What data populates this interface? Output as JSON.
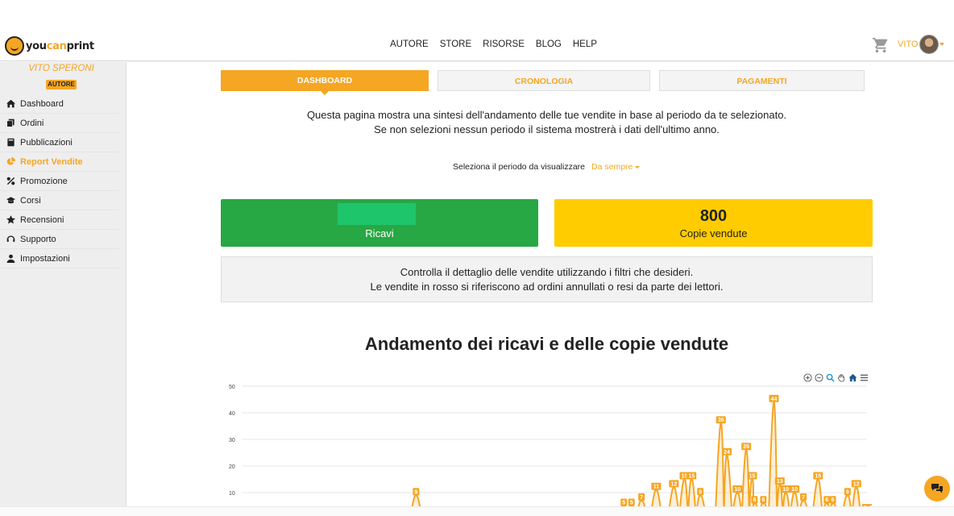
{
  "header": {
    "logo": {
      "you": "you",
      "can": "can",
      "print": "print"
    },
    "nav": [
      "AUTORE",
      "STORE",
      "RISORSE",
      "BLOG",
      "HELP"
    ],
    "user_name": "VITO",
    "accent": "#f5a623"
  },
  "sidebar": {
    "user": "VITO SPERONI",
    "role_badge": "AUTORE",
    "items": [
      {
        "label": "Dashboard",
        "icon": "home-icon"
      },
      {
        "label": "Ordini",
        "icon": "copy-icon"
      },
      {
        "label": "Pubblicazioni",
        "icon": "book-icon"
      },
      {
        "label": "Report Vendite",
        "icon": "pie-chart-icon",
        "active": true
      },
      {
        "label": "Promozione",
        "icon": "percent-icon"
      },
      {
        "label": "Corsi",
        "icon": "graduation-cap-icon"
      },
      {
        "label": "Recensioni",
        "icon": "star-icon"
      },
      {
        "label": "Supporto",
        "icon": "headset-icon"
      },
      {
        "label": "Impostazioni",
        "icon": "user-icon"
      }
    ]
  },
  "tabs": {
    "dashboard": "DASHBOARD",
    "cronologia": "CRONOLOGIA",
    "pagamenti": "PAGAMENTI"
  },
  "intro": {
    "line1": "Questa pagina mostra una sintesi dell'andamento delle tue vendite in base al periodo da te selezionato.",
    "line2": "Se non selezioni nessun periodo il sistema mostrerà i dati dell'ultimo anno."
  },
  "period": {
    "label": "Seleziona il periodo da visualizzare",
    "value": "Da sempre"
  },
  "stats": {
    "revenue_label": "Ricavi",
    "copies_value": "800",
    "copies_label": "Copie vendute",
    "colors": {
      "revenue": "#28a745",
      "copies": "#ffcc00"
    }
  },
  "info": {
    "line1": "Controlla il dettaglio delle vendite utilizzando i filtri che desideri.",
    "line2": "Le vendite in rosso si riferiscono ad ordini annullati o resi da parte dei lettori."
  },
  "chart_data": {
    "type": "area",
    "title": "Andamento dei ricavi e delle copie vendute",
    "yticks": [
      10,
      20,
      30,
      40,
      50
    ],
    "ylim": [
      0,
      50
    ],
    "grid": true,
    "series_color": "#f5a623",
    "points": [
      {
        "x": 0.25,
        "y": 2
      },
      {
        "x": 0.282,
        "y": 9,
        "label": "9"
      },
      {
        "x": 0.335,
        "y": 3
      },
      {
        "x": 0.635,
        "y": 5,
        "label": "5"
      },
      {
        "x": 0.648,
        "y": 5,
        "label": "5"
      },
      {
        "x": 0.665,
        "y": 7,
        "label": "7"
      },
      {
        "x": 0.69,
        "y": 11,
        "label": "11"
      },
      {
        "x": 0.72,
        "y": 12,
        "label": "12"
      },
      {
        "x": 0.738,
        "y": 15,
        "label": "15"
      },
      {
        "x": 0.75,
        "y": 15,
        "label": "15"
      },
      {
        "x": 0.765,
        "y": 9,
        "label": "9"
      },
      {
        "x": 0.8,
        "y": 36,
        "label": "36"
      },
      {
        "x": 0.81,
        "y": 24,
        "label": "24"
      },
      {
        "x": 0.828,
        "y": 10,
        "label": "10"
      },
      {
        "x": 0.843,
        "y": 26,
        "label": "26"
      },
      {
        "x": 0.853,
        "y": 15,
        "label": "15"
      },
      {
        "x": 0.857,
        "y": 6,
        "label": "6"
      },
      {
        "x": 0.872,
        "y": 6,
        "label": "6"
      },
      {
        "x": 0.89,
        "y": 44,
        "label": "44"
      },
      {
        "x": 0.9,
        "y": 13,
        "label": "13"
      },
      {
        "x": 0.91,
        "y": 10,
        "label": "10"
      },
      {
        "x": 0.925,
        "y": 10,
        "label": "10"
      },
      {
        "x": 0.94,
        "y": 7,
        "label": "7"
      },
      {
        "x": 0.965,
        "y": 15,
        "label": "15"
      },
      {
        "x": 0.98,
        "y": 6,
        "label": "6"
      },
      {
        "x": 0.99,
        "y": 6,
        "label": "6"
      },
      {
        "x": 1.015,
        "y": 9,
        "label": "9"
      },
      {
        "x": 1.03,
        "y": 12,
        "label": "12"
      },
      {
        "x": 1.045,
        "y": 3,
        "label": "3"
      },
      {
        "x": 1.055,
        "y": 3,
        "label": "3"
      },
      {
        "x": 1.07,
        "y": 10,
        "label": "10"
      }
    ]
  }
}
